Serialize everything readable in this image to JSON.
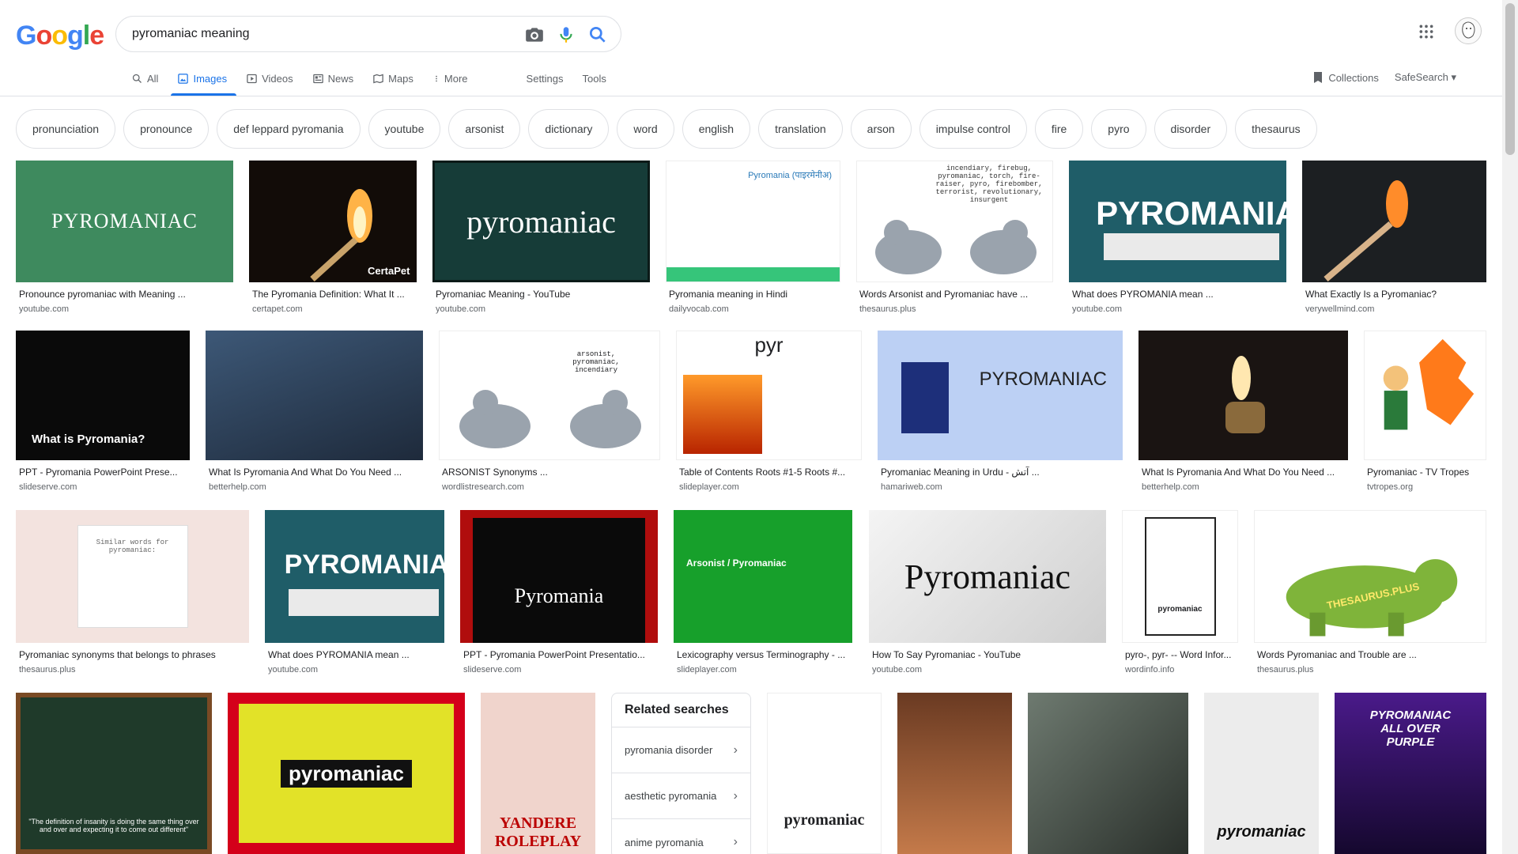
{
  "logo": {
    "g1": "G",
    "o1": "o",
    "o2": "o",
    "g2": "g",
    "l": "l",
    "e": "e"
  },
  "search": {
    "query": "pyromaniac meaning"
  },
  "tabs": [
    {
      "label": "All",
      "icon": "search-icon"
    },
    {
      "label": "Images",
      "icon": "image-icon"
    },
    {
      "label": "Videos",
      "icon": "video-icon"
    },
    {
      "label": "News",
      "icon": "news-icon"
    },
    {
      "label": "Maps",
      "icon": "map-icon"
    },
    {
      "label": "More",
      "icon": "more-vert-icon"
    }
  ],
  "tools": {
    "settings": "Settings",
    "tools": "Tools"
  },
  "right": {
    "collections": "Collections",
    "safesearch": "SafeSearch"
  },
  "chips": [
    "pronunciation",
    "pronounce",
    "def leppard pyromania",
    "youtube",
    "arsonist",
    "dictionary",
    "word",
    "english",
    "translation",
    "arson",
    "impulse control",
    "fire",
    "pyro",
    "disorder",
    "thesaurus"
  ],
  "rows": [
    [
      {
        "caption": "Pronounce pyromaniac with Meaning ...",
        "source": "youtube.com",
        "text": "PYROMANIAC"
      },
      {
        "caption": "The Pyromania Definition: What It ...",
        "source": "certapet.com",
        "text": "CertaPet"
      },
      {
        "caption": "Pyromaniac Meaning - YouTube",
        "source": "youtube.com",
        "text": "pyromaniac"
      },
      {
        "caption": "Pyromania meaning in Hindi",
        "source": "dailyvocab.com",
        "text": "Pyromania (पाइरमेनीअ)"
      },
      {
        "caption": "Words Arsonist and Pyromaniac have ...",
        "source": "thesaurus.plus",
        "text": "incendiary, firebug, pyromaniac, torch, fire-raiser, pyro, firebomber, terrorist, revolutionary, insurgent"
      },
      {
        "caption": "What does PYROMANIA mean ...",
        "source": "youtube.com",
        "text": "PYROMANIA"
      },
      {
        "caption": "What Exactly Is a Pyromaniac?",
        "source": "verywellmind.com",
        "text": ""
      }
    ],
    [
      {
        "caption": "PPT - Pyromania PowerPoint Prese...",
        "source": "slideserve.com",
        "text": "What is Pyromania?"
      },
      {
        "caption": "What Is Pyromania And What Do You Need ...",
        "source": "betterhelp.com",
        "text": ""
      },
      {
        "caption": "ARSONIST Synonyms ...",
        "source": "wordlistresearch.com",
        "text": "arsonist, pyromaniac, incendiary"
      },
      {
        "caption": "Table of Contents Roots #1-5 Roots #...",
        "source": "slideplayer.com",
        "text": "pyr"
      },
      {
        "caption": "Pyromaniac Meaning in Urdu - آتش ...",
        "source": "hamariweb.com",
        "text": "PYROMANIAC"
      },
      {
        "caption": "What Is Pyromania And What Do You Need ...",
        "source": "betterhelp.com",
        "text": ""
      },
      {
        "caption": "Pyromaniac - TV Tropes",
        "source": "tvtropes.org",
        "text": ""
      }
    ],
    [
      {
        "caption": "Pyromaniac synonyms that belongs to phrases",
        "source": "thesaurus.plus",
        "text": "Similar words for pyromaniac:"
      },
      {
        "caption": "What does PYROMANIA mean ...",
        "source": "youtube.com",
        "text": "PYROMANIA"
      },
      {
        "caption": "PPT - Pyromania PowerPoint Presentatio...",
        "source": "slideserve.com",
        "text": "Pyromania"
      },
      {
        "caption": "Lexicography versus Terminography - ...",
        "source": "slideplayer.com",
        "text": "Arsonist / Pyromaniac"
      },
      {
        "caption": "How To Say Pyromaniac - YouTube",
        "source": "youtube.com",
        "text": "Pyromaniac"
      },
      {
        "caption": "pyro-, pyr- -- Word Infor...",
        "source": "wordinfo.info",
        "text": "pyromaniac"
      },
      {
        "caption": "Words Pyromaniac and Trouble are ...",
        "source": "thesaurus.plus",
        "text": "THESAURUS.PLUS"
      }
    ],
    [
      {
        "text": "\"The definition of insanity is doing the same thing over and over and expecting it to come out different\""
      },
      {
        "text": "pyromaniac"
      },
      {
        "text": "YANDERE ROLEPLAY"
      },
      {
        "text": "pyromaniac"
      },
      {
        "text": ""
      },
      {
        "text": ""
      },
      {
        "text": "pyromaniac"
      },
      {
        "text": "PYROMANIAC ALL OVER PURPLE"
      }
    ]
  ],
  "related": {
    "title": "Related searches",
    "items": [
      "pyromania disorder",
      "aesthetic pyromania",
      "anime pyromania"
    ]
  }
}
